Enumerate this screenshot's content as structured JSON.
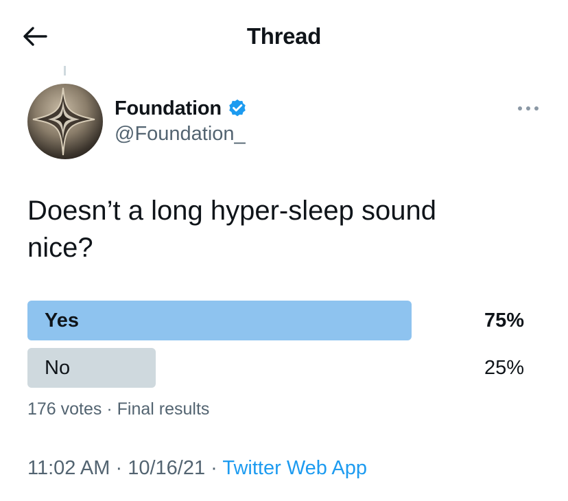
{
  "header": {
    "title": "Thread",
    "back_icon": "arrow-left-icon"
  },
  "author": {
    "display_name": "Foundation",
    "handle": "@Foundation_",
    "verified": true,
    "verified_icon": "verified-badge-icon",
    "avatar": "foundation-star-logo"
  },
  "more_icon": "more-dots-icon",
  "tweet": {
    "text_line1": "Doesn’t a long hyper-sleep sound",
    "text_line2": "nice?"
  },
  "poll": {
    "options": [
      {
        "label": "Yes",
        "percent_text": "75%",
        "percent": 75,
        "winner": true
      },
      {
        "label": "No",
        "percent_text": "25%",
        "percent": 25,
        "winner": false
      }
    ],
    "votes": "176 votes",
    "separator": "·",
    "status": "Final results"
  },
  "meta": {
    "time": "11:02 AM",
    "date": "10/16/21",
    "separator": "·",
    "source": "Twitter Web App"
  },
  "colors": {
    "winner_bar": "#8ec3ef",
    "loser_bar": "#cfd9de",
    "link": "#1d9bf0",
    "secondary_text": "#536471",
    "verified": "#1d9bf0"
  }
}
